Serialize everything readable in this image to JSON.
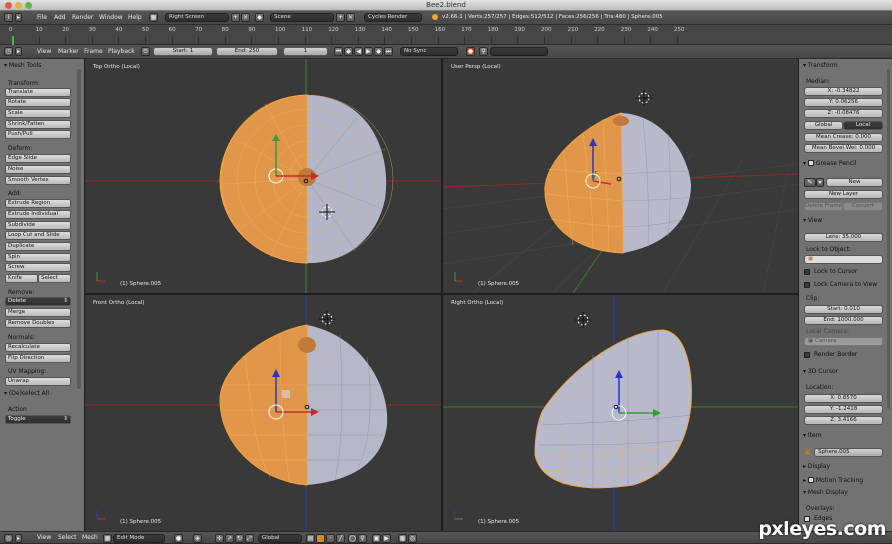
{
  "window": {
    "title": "Bee2.blend"
  },
  "info_header": {
    "menus": [
      "File",
      "Add",
      "Render",
      "Window",
      "Help"
    ],
    "screen": "Right Screen",
    "scene": "Scene",
    "engine": "Cycles Render",
    "stats": "v2.66.1 | Verts:257/257 | Edges:512/512 | Faces:256/256 | Tris:480 | Sphere.005"
  },
  "timeline": {
    "ticks": [
      "0",
      "10",
      "20",
      "30",
      "40",
      "50",
      "60",
      "70",
      "80",
      "90",
      "100",
      "110",
      "120",
      "130",
      "140",
      "150",
      "160",
      "170",
      "180",
      "190",
      "200",
      "210",
      "220",
      "230",
      "240",
      "250"
    ],
    "menus": [
      "View",
      "Marker",
      "Frame",
      "Playback"
    ],
    "start": "Start: 1",
    "end": "End: 250",
    "current": "1",
    "sync": "No Sync"
  },
  "toolshelf": {
    "title": "Mesh Tools",
    "transform_label": "Transform:",
    "transform": [
      "Translate",
      "Rotate",
      "Scale",
      "Shrink/Fatten",
      "Push/Pull"
    ],
    "deform_label": "Deform:",
    "deform": [
      "Edge Slide",
      "Noise",
      "Smooth Vertex"
    ],
    "add_label": "Add:",
    "add": [
      "Extrude Region",
      "Extrude Individual",
      "Subdivide",
      "Loop Cut and Slide",
      "Duplicate",
      "Spin",
      "Screw"
    ],
    "knife": "Knife",
    "select": "Select",
    "remove_label": "Remove:",
    "remove_select": "Delete",
    "remove": [
      "Merge",
      "Remove Doubles"
    ],
    "normals_label": "Normals:",
    "normals": [
      "Recalculate",
      "Flip Direction"
    ],
    "uv_label": "UV Mapping:",
    "uv": [
      "Unwrap"
    ],
    "deselect_title": "(De)select All",
    "action_label": "Action",
    "action_value": "Toggle"
  },
  "viewports": {
    "top_left": {
      "title": "Top Ortho (Local)",
      "object": "(1) Sphere.005"
    },
    "top_right": {
      "title": "User Persp (Local)",
      "object": "(1) Sphere.005"
    },
    "bottom_left": {
      "title": "Front Ortho (Local)",
      "object": "(1) Sphere.005"
    },
    "bottom_right": {
      "title": "Right Ortho (Local)",
      "object": "(1) Sphere.005"
    }
  },
  "properties": {
    "transform_title": "Transform",
    "median_label": "Median:",
    "x": "X: -0.34822",
    "y": "Y: 0.06256",
    "z": "Z: -0.08476",
    "global": "Global",
    "local": "Local",
    "mean_crease": "Mean Crease: 0.000",
    "mean_bevel": "Mean Bevel Wei: 0.000",
    "grease_title": "Grease Pencil",
    "new": "New",
    "new_layer": "New Layer",
    "delete_frame": "Delete Frame",
    "convert": "Convert",
    "view_title": "View",
    "lens": "Lens: 35.000",
    "lock_object_label": "Lock to Object:",
    "lock_cursor": "Lock to Cursor",
    "lock_camera": "Lock Camera to View",
    "clip_label": "Clip:",
    "clip_start": "Start: 0.010",
    "clip_end": "End: 1000.000",
    "local_camera_label": "Local Camera:",
    "camera": "Camera",
    "render_border": "Render Border",
    "cursor_title": "3D Cursor",
    "location_label": "Location:",
    "cx": "X: 0.8570",
    "cy": "Y: -1.2418",
    "cz": "Z: 3.4166",
    "item_title": "Item",
    "item_name": "Sphere.005",
    "display_title": "Display",
    "motion_title": "Motion Tracking",
    "mesh_display_title": "Mesh Display",
    "overlays_label": "Overlays:",
    "edges": "Edges"
  },
  "footer": {
    "menus": [
      "View",
      "Select",
      "Mesh"
    ],
    "mode": "Edit Mode",
    "orientation": "Global"
  },
  "watermark": "pxleyes.com",
  "colors": {
    "accent_orange": "#f2a33a",
    "selected_face": "#e39b45",
    "unselected_face": "#b9bccc",
    "axis_red": "#a52020",
    "axis_green": "#3b8a2a",
    "axis_blue": "#2a36c8"
  }
}
